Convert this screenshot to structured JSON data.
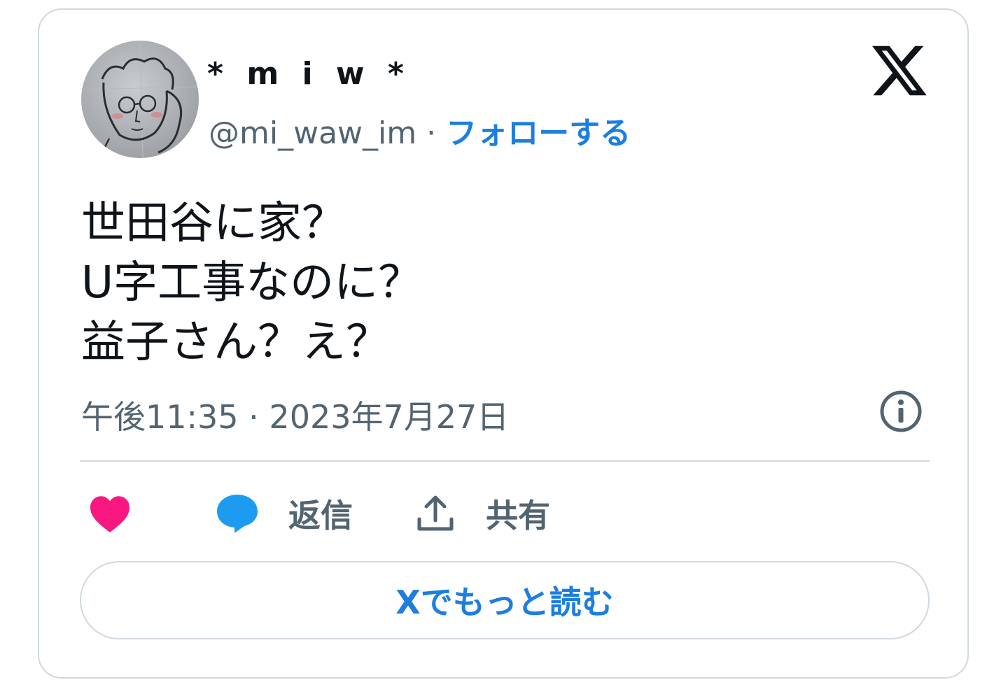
{
  "author": {
    "display_name": "* m i w *",
    "handle": "@mi_waw_im",
    "separator": "·",
    "follow_label": "フォローする"
  },
  "tweet": {
    "lines": [
      "世田谷に家？",
      "U字工事なのに？",
      "益子さん？え？"
    ],
    "timestamp": "午後11:35 · 2023年7月27日"
  },
  "actions": {
    "like_icon": "heart-icon",
    "reply_label": "返信",
    "reply_icon": "speech-bubble-icon",
    "share_label": "共有",
    "share_icon": "upload-icon"
  },
  "read_more_label": "Xでもっと読む",
  "icons": {
    "brand": "x-logo-icon",
    "info": "info-icon"
  },
  "colors": {
    "accent_blue": "#1d7ee0",
    "like_pink": "#f91880",
    "reply_blue": "#1d9bf0",
    "text_primary": "#0f1419",
    "text_secondary": "#536471",
    "border": "#cfd9de"
  }
}
